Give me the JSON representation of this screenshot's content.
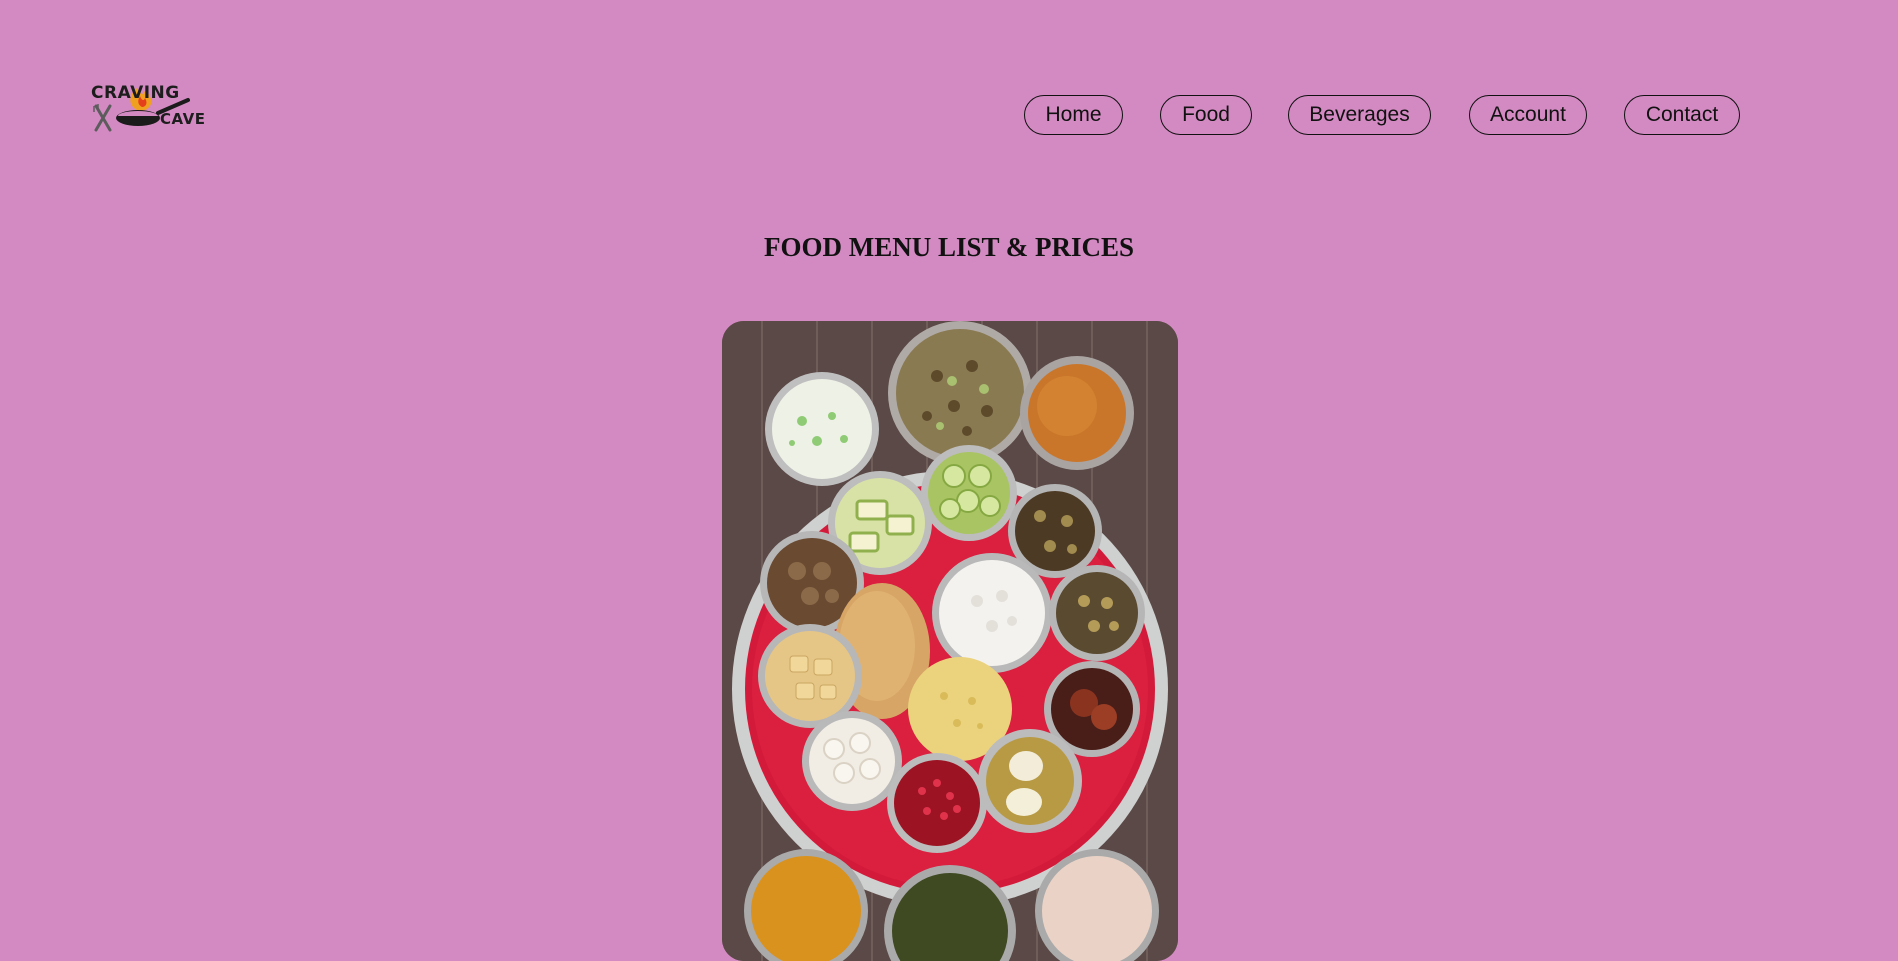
{
  "logo": {
    "line1": "CRAVING",
    "line2": "CAVE"
  },
  "nav": {
    "items": [
      {
        "label": "Home"
      },
      {
        "label": "Food"
      },
      {
        "label": "Beverages"
      },
      {
        "label": "Account"
      },
      {
        "label": "Contact"
      }
    ]
  },
  "main": {
    "title": "FOOD MENU LIST & PRICES"
  },
  "colors": {
    "background": "#d38ac2",
    "text": "#111111",
    "plate_red": "#d41a3a"
  }
}
